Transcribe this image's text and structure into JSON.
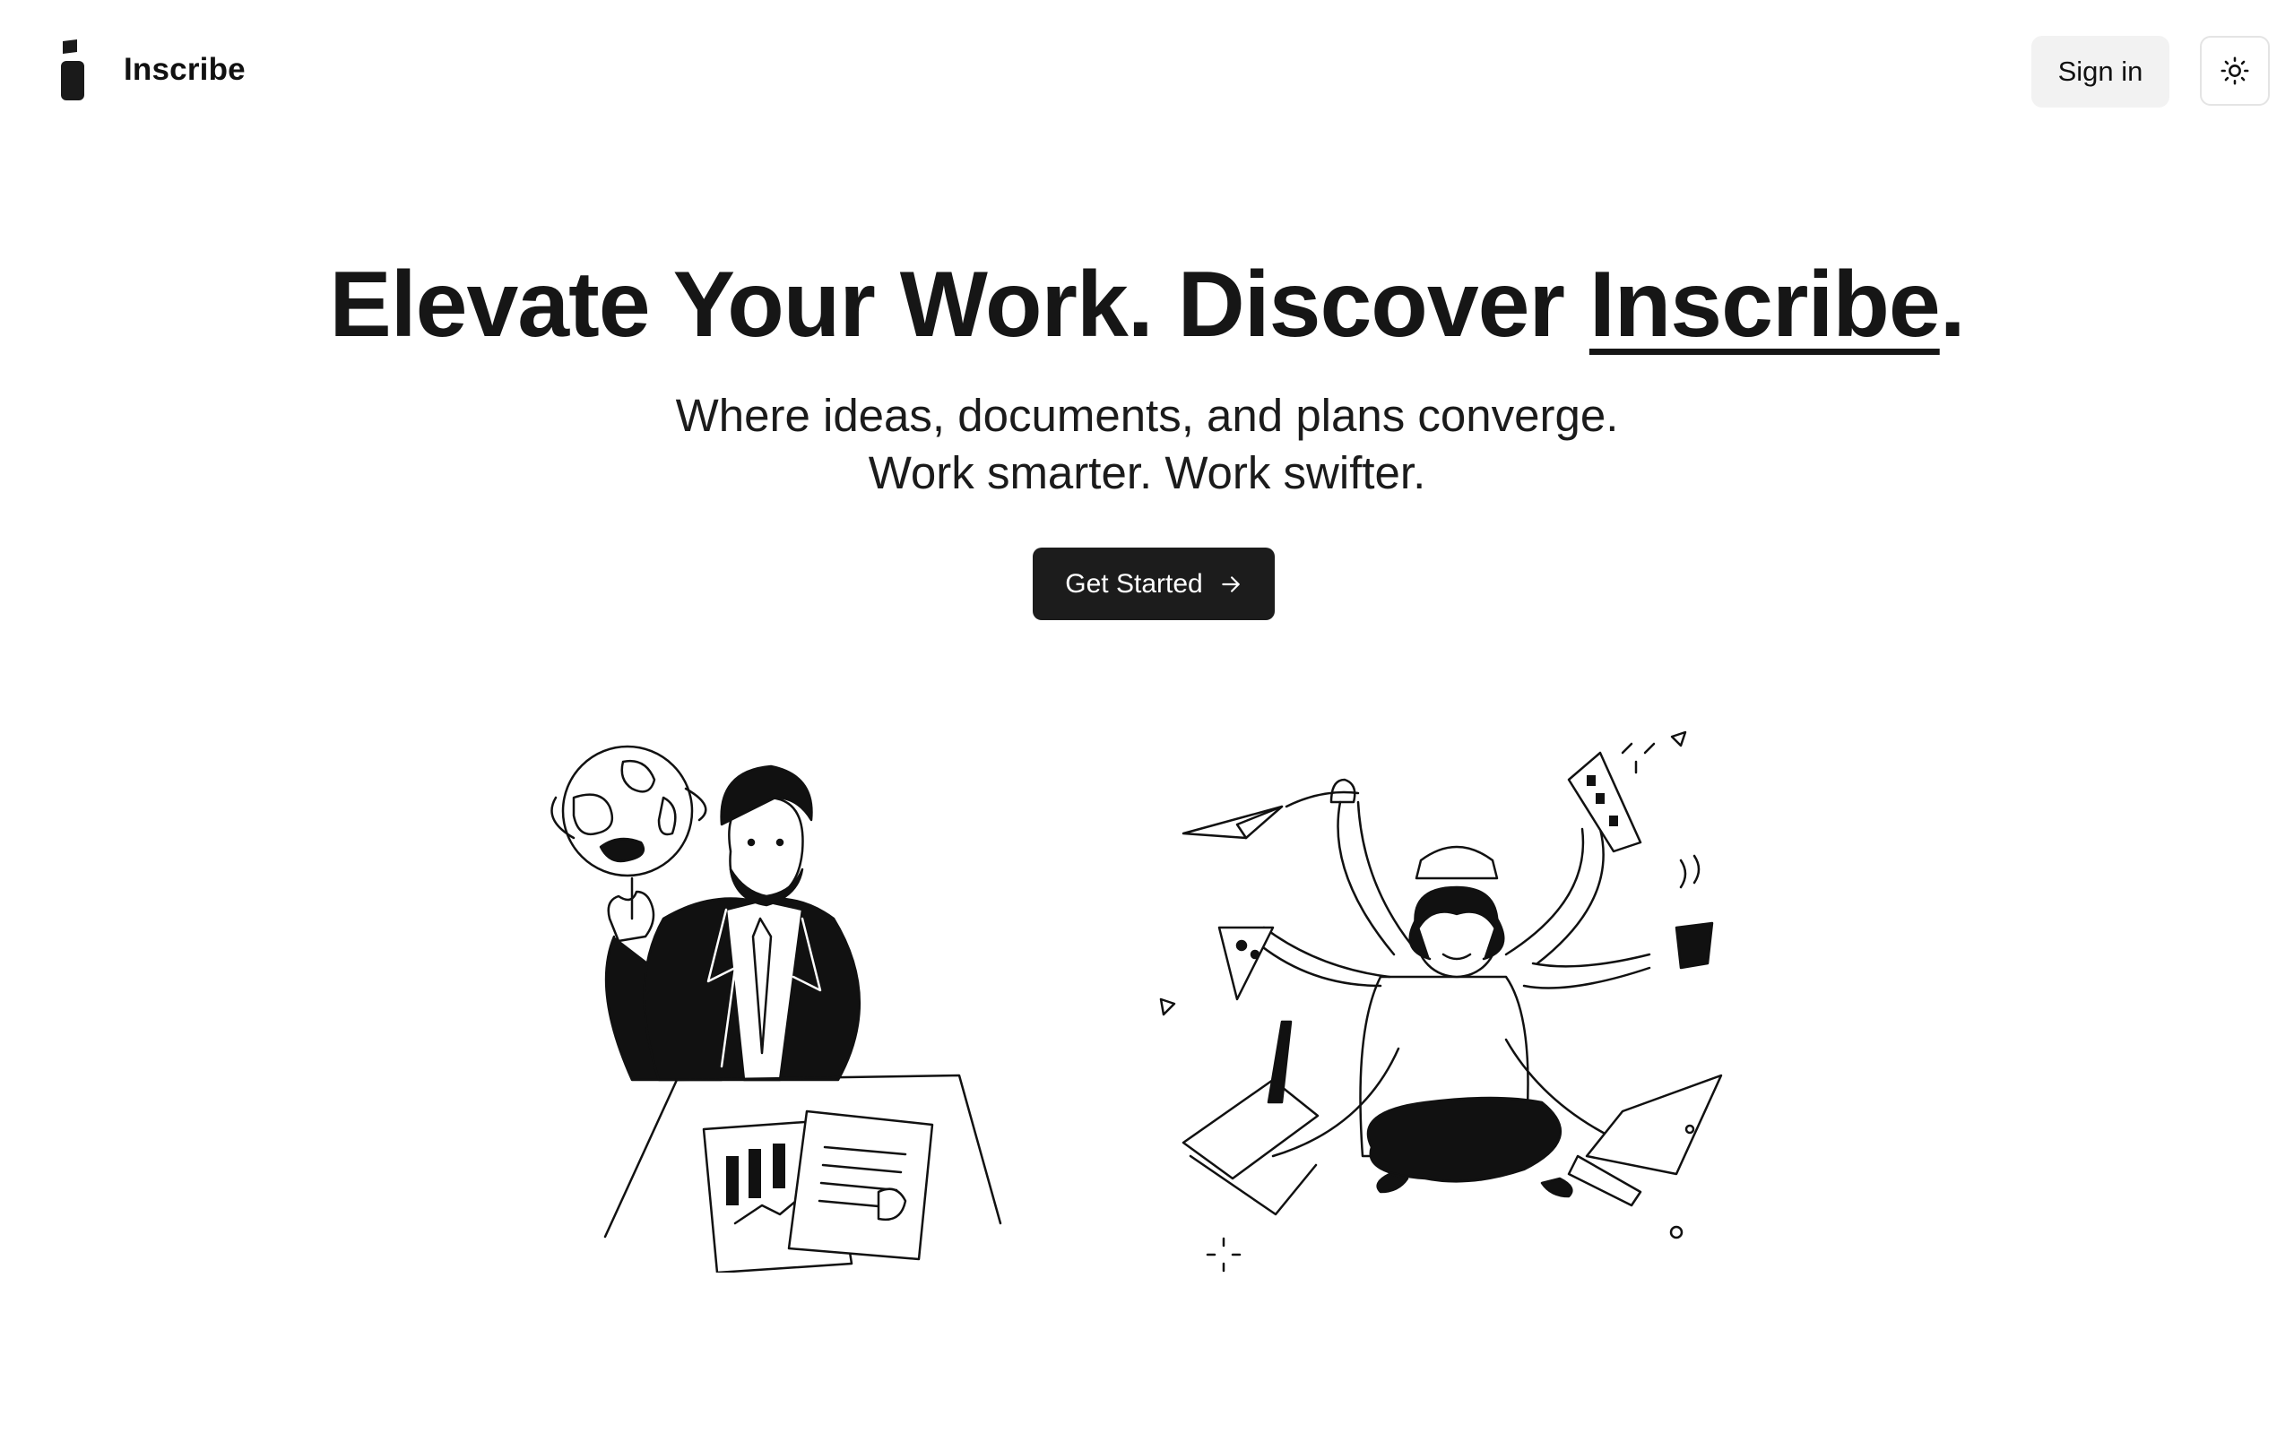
{
  "header": {
    "brand": "Inscribe",
    "signin_label": "Sign in",
    "theme_toggle_icon": "sun-icon"
  },
  "hero": {
    "title_prefix": "Elevate Your Work. Discover ",
    "title_brand": "Inscribe",
    "title_suffix": ".",
    "subtitle_line1": "Where ideas, documents, and plans converge.",
    "subtitle_line2": "Work smarter. Work swifter.",
    "cta_label": "Get Started",
    "cta_icon": "arrow-right-icon"
  },
  "illustrations": {
    "left": "businessman-globe-illustration",
    "right": "multitasking-woman-illustration"
  },
  "colors": {
    "ink": "#161616",
    "button_dark": "#1c1c1c",
    "button_light": "#f2f2f2",
    "background": "#ffffff"
  }
}
